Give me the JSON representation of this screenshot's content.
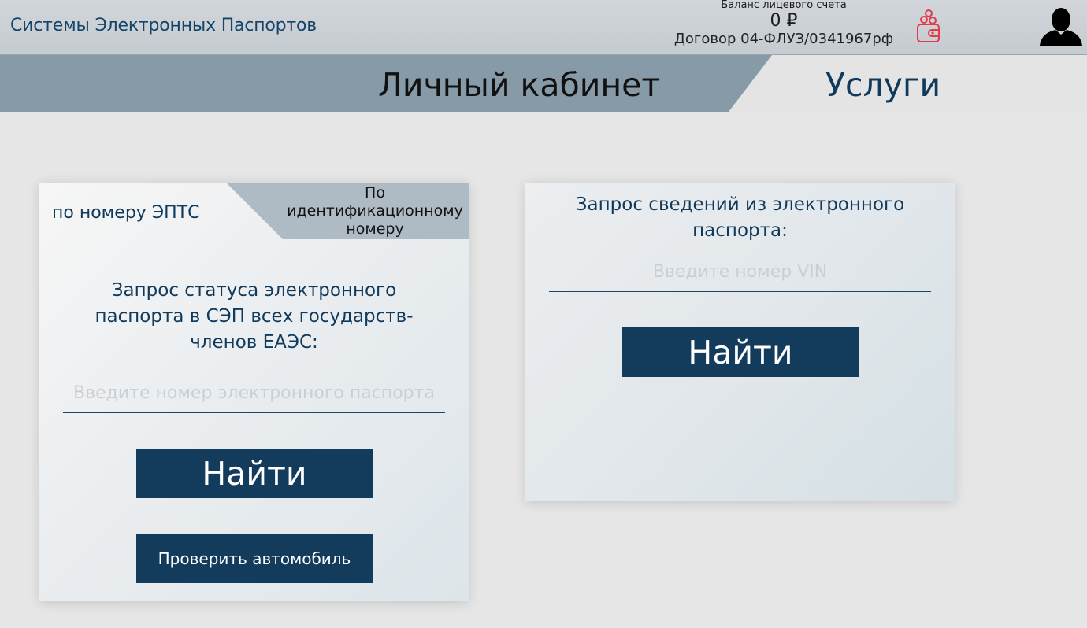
{
  "header": {
    "brand": "Системы Электронных Паспортов",
    "balance_label": "Баланс лицевого счета",
    "balance_amount": "0 ₽",
    "contract": "Договор 04-ФЛУЗ/0341967рф"
  },
  "icons": {
    "wallet": "wallet-icon",
    "avatar": "user-avatar-icon"
  },
  "colors": {
    "accent": "#133b5b",
    "brand_text": "#14446a",
    "wallet_icon": "#e03c4a",
    "tab_bg": "#869aa8"
  },
  "tabs": {
    "cabinet": "Личный кабинет",
    "services": "Услуги"
  },
  "left_panel": {
    "subtab_active": "по номеру ЭПТС",
    "subtab_inactive_lines": [
      "По",
      "идентификационному",
      "номеру"
    ],
    "title_lines": [
      "Запрос статуса электронного",
      "паспорта в СЭП всех государств-",
      "членов ЕАЭС:"
    ],
    "input_placeholder": "Введите номер электронного паспорта",
    "find_button": "Найти",
    "check_button": "Проверить автомобиль"
  },
  "right_panel": {
    "title_lines": [
      "Запрос сведений из электронного",
      "паспорта:"
    ],
    "input_placeholder": "Введите номер VIN",
    "find_button": "Найти"
  }
}
